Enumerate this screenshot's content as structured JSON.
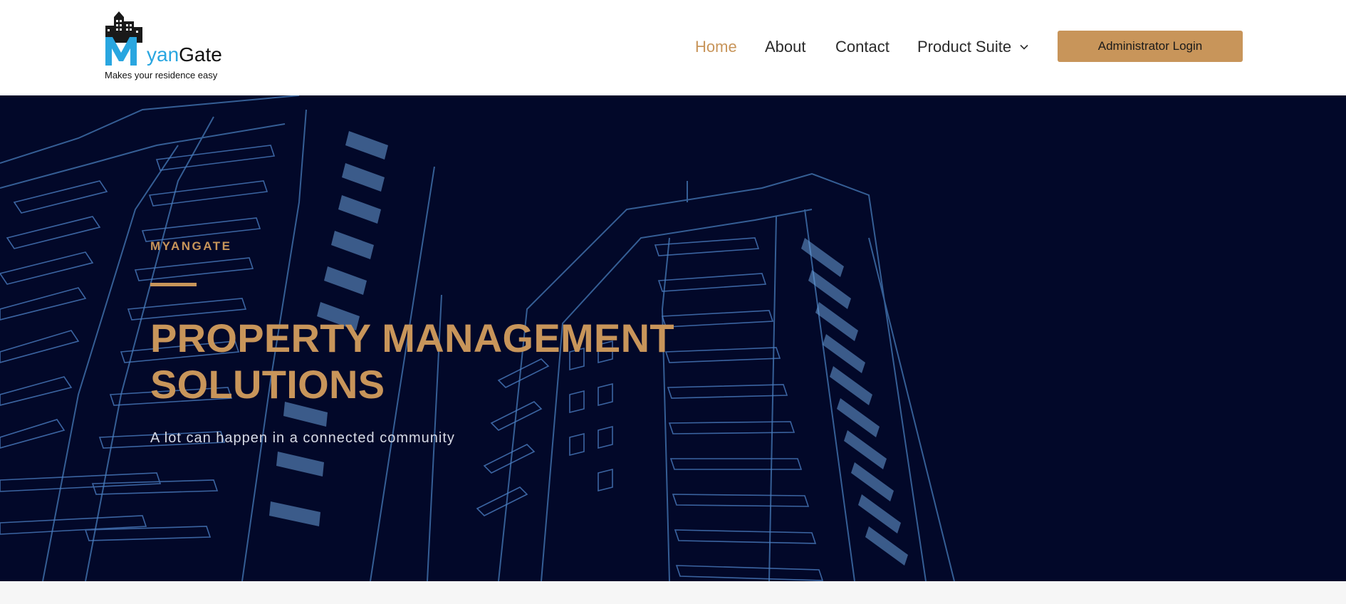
{
  "brand": {
    "name_part1": "M",
    "name_part2": "yan",
    "name_part3": "Gate",
    "tagline": "Makes your residence easy",
    "logo_icon": "buildings-icon",
    "colors": {
      "blue": "#29a6e0",
      "dark": "#111111"
    }
  },
  "nav": {
    "items": [
      {
        "label": "Home",
        "active": true
      },
      {
        "label": "About"
      },
      {
        "label": "Contact"
      },
      {
        "label": "Product Suite",
        "icon": "chevron-down-icon"
      }
    ],
    "cta_label": "Administrator Login"
  },
  "hero": {
    "eyebrow": "MYANGATE",
    "title_line1": "PROPERTY MANAGEMENT",
    "title_line2": "SOLUTIONS",
    "subtitle": "A lot can happen in a connected community",
    "background_image": "wireframe-buildings-illustration"
  },
  "colors": {
    "accent": "#c8955a",
    "hero_bg": "#020829",
    "nav_text": "#2b2b2b"
  }
}
